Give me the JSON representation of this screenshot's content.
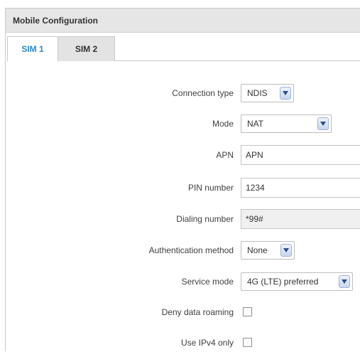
{
  "panel": {
    "title": "Mobile Configuration"
  },
  "tabs": [
    {
      "label": "SIM 1",
      "active": true
    },
    {
      "label": "SIM 2",
      "active": false
    }
  ],
  "fields": {
    "connection_type": {
      "label": "Connection type",
      "value": "NDIS"
    },
    "mode": {
      "label": "Mode",
      "value": "NAT"
    },
    "apn": {
      "label": "APN",
      "value": "APN"
    },
    "pin_number": {
      "label": "PIN number",
      "value": "1234"
    },
    "dialing_number": {
      "label": "Dialing number",
      "value": "*99#"
    },
    "auth_method": {
      "label": "Authentication method",
      "value": "None"
    },
    "service_mode": {
      "label": "Service mode",
      "value": "4G (LTE) preferred"
    },
    "deny_roaming": {
      "label": "Deny data roaming",
      "checked": false
    },
    "ipv4_only": {
      "label": "Use IPv4 only",
      "checked": false
    }
  },
  "colors": {
    "accent": "#2a8bcf",
    "header_bg": "#e6e6e6",
    "inactive_tab_bg": "#e3e3e3"
  },
  "icons": {
    "dropdown": "chevron-down-icon"
  }
}
